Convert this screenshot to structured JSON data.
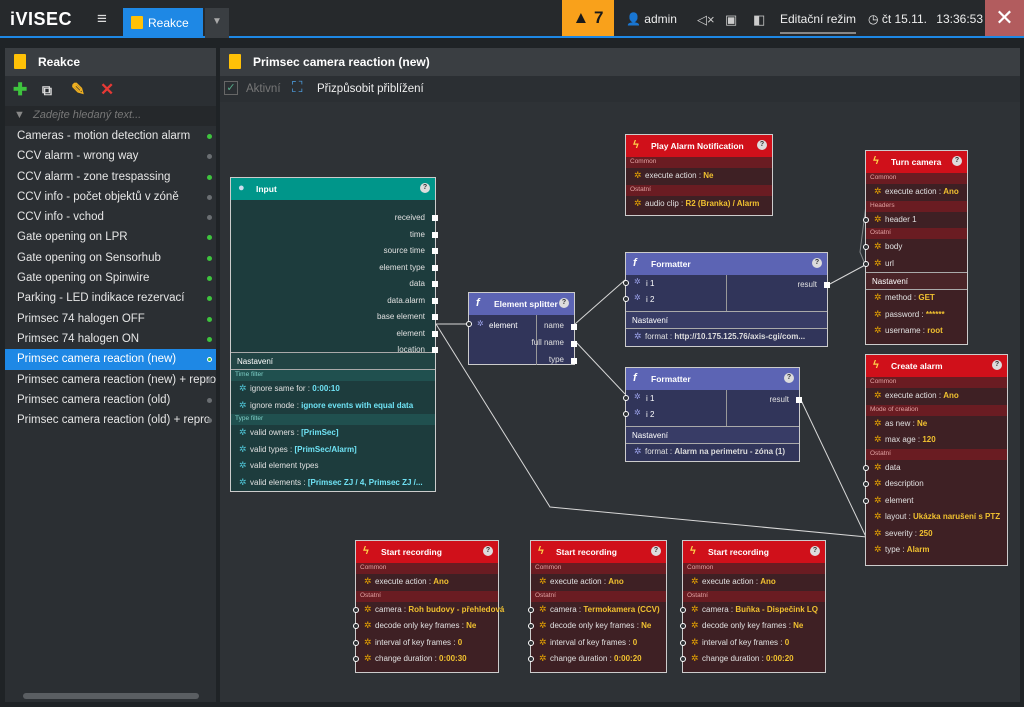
{
  "app": {
    "logo": "iVISEC",
    "menu_icon": "hamburger-icon"
  },
  "tab": {
    "label": "Reakce"
  },
  "alarm": {
    "count": "▲ 7"
  },
  "user": {
    "name": "admin"
  },
  "topbar": {
    "mode": "Editační režim",
    "date": "čt 15.11.",
    "time": "13:36:53"
  },
  "left": {
    "title": "Reakce",
    "search_placeholder": "Zadejte hledaný text...",
    "items": [
      {
        "label": "Cameras - motion detection alarm",
        "status": "green"
      },
      {
        "label": "CCV alarm - wrong way",
        "status": "gray"
      },
      {
        "label": "CCV alarm - zone trespassing",
        "status": "green"
      },
      {
        "label": "CCV info - počet objektů v zóně",
        "status": "gray"
      },
      {
        "label": "CCV info - vchod",
        "status": "gray"
      },
      {
        "label": "Gate opening on LPR",
        "status": "green"
      },
      {
        "label": "Gate opening on Sensorhub",
        "status": "green"
      },
      {
        "label": "Gate opening on Spinwire",
        "status": "green"
      },
      {
        "label": "Parking - LED indikace rezervací",
        "status": "green"
      },
      {
        "label": "Primsec 74 halogen OFF",
        "status": "green"
      },
      {
        "label": "Primsec 74 halogen ON",
        "status": "green"
      },
      {
        "label": "Primsec camera reaction (new)",
        "status": "green",
        "selected": true
      },
      {
        "label": "Primsec camera reaction (new) + repro",
        "status": "gray"
      },
      {
        "label": "Primsec camera reaction (old)",
        "status": "gray"
      },
      {
        "label": "Primsec camera reaction (old) + repro",
        "status": "gray"
      }
    ]
  },
  "main": {
    "title": "Primsec camera reaction (new)",
    "active": "Aktivní",
    "fit": "Přizpůsobit přiblížení"
  },
  "nodes": {
    "input": {
      "title": "Input",
      "outputs": [
        "received",
        "time",
        "source time",
        "element type",
        "data",
        "data.alarm",
        "base element",
        "element",
        "location"
      ],
      "nastaveni": "Nastavení",
      "sec1": "Time filter",
      "p1k": "ignore same for : ",
      "p1v": "0:00:10",
      "p2k": "ignore mode : ",
      "p2v": "ignore events with equal data",
      "sec2": "Type filter",
      "p3k": "valid owners : ",
      "p3v": "[PrimSec]",
      "p4k": "valid types : ",
      "p4v": "[PrimSec/Alarm]",
      "p5k": "valid element types",
      "p6k": "valid elements : ",
      "p6v": "[Primsec ZJ / 4, Primsec ZJ /..."
    },
    "splitter": {
      "title": "Element splitter",
      "input": "element",
      "o1": "name",
      "o2": "full name",
      "o3": "type"
    },
    "play": {
      "title": "Play Alarm Notification",
      "sec1": "Common",
      "p1k": "execute action : ",
      "p1v": "Ne",
      "sec2": "Ostatní",
      "p2k": "audio clip : ",
      "p2v": "R2 (Branka) / Alarm"
    },
    "fmt1": {
      "title": "Formatter",
      "i1": "i 1",
      "i2": "i 2",
      "out": "result",
      "nastaveni": "Nastavení",
      "fk": "format : ",
      "fv": "http://10.175.125.76/axis-cgi/com..."
    },
    "fmt2": {
      "title": "Formatter",
      "i1": "i 1",
      "i2": "i 2",
      "out": "result",
      "nastaveni": "Nastavení",
      "fk": "format : ",
      "fv": "Alarm na perimetru - zóna (1)"
    },
    "turn": {
      "title": "Turn camera",
      "sec1": "Common",
      "p1k": "execute action : ",
      "p1v": "Ano",
      "sec2": "Headers",
      "h1": "header 1",
      "sec3": "Ostatní",
      "body": "body",
      "url": "url",
      "nastaveni": "Nastavení",
      "mk": "method : ",
      "mv": "GET",
      "pk": "password : ",
      "pv": "******",
      "uk": "username : ",
      "uv": "root"
    },
    "create": {
      "title": "Create alarm",
      "sec1": "Common",
      "p1k": "execute action : ",
      "p1v": "Ano",
      "sec2": "Mode of creation",
      "p2k": "as new : ",
      "p2v": "Ne",
      "p3k": "max age : ",
      "p3v": "120",
      "sec3": "Ostatní",
      "d1": "data",
      "d2": "description",
      "d3": "element",
      "lk": "layout : ",
      "lv": "Ukázka narušení s PTZ",
      "sk": "severity : ",
      "sv": "250",
      "tk": "type : ",
      "tv": "Alarm"
    },
    "rec1": {
      "title": "Start recording",
      "sec1": "Common",
      "p1k": "execute action : ",
      "p1v": "Ano",
      "sec2": "Ostatní",
      "ck": "camera : ",
      "cv": "Roh budovy - přehledová",
      "dk": "decode only key frames : ",
      "dv": "Ne",
      "ik": "interval of key frames : ",
      "iv": "0",
      "hk": "change duration : ",
      "hv": "0:00:30"
    },
    "rec2": {
      "title": "Start recording",
      "sec1": "Common",
      "p1k": "execute action : ",
      "p1v": "Ano",
      "sec2": "Ostatní",
      "ck": "camera : ",
      "cv": "Termokamera (CCV)",
      "dk": "decode only key frames : ",
      "dv": "Ne",
      "ik": "interval of key frames : ",
      "iv": "0",
      "hk": "change duration : ",
      "hv": "0:00:20"
    },
    "rec3": {
      "title": "Start recording",
      "sec1": "Common",
      "p1k": "execute action : ",
      "p1v": "Ano",
      "sec2": "Ostatní",
      "ck": "camera : ",
      "cv": "Buňka - Dispečink LQ",
      "dk": "decode only key frames : ",
      "dv": "Ne",
      "ik": "interval of key frames : ",
      "iv": "0",
      "hk": "change duration : ",
      "hv": "0:00:20"
    }
  }
}
